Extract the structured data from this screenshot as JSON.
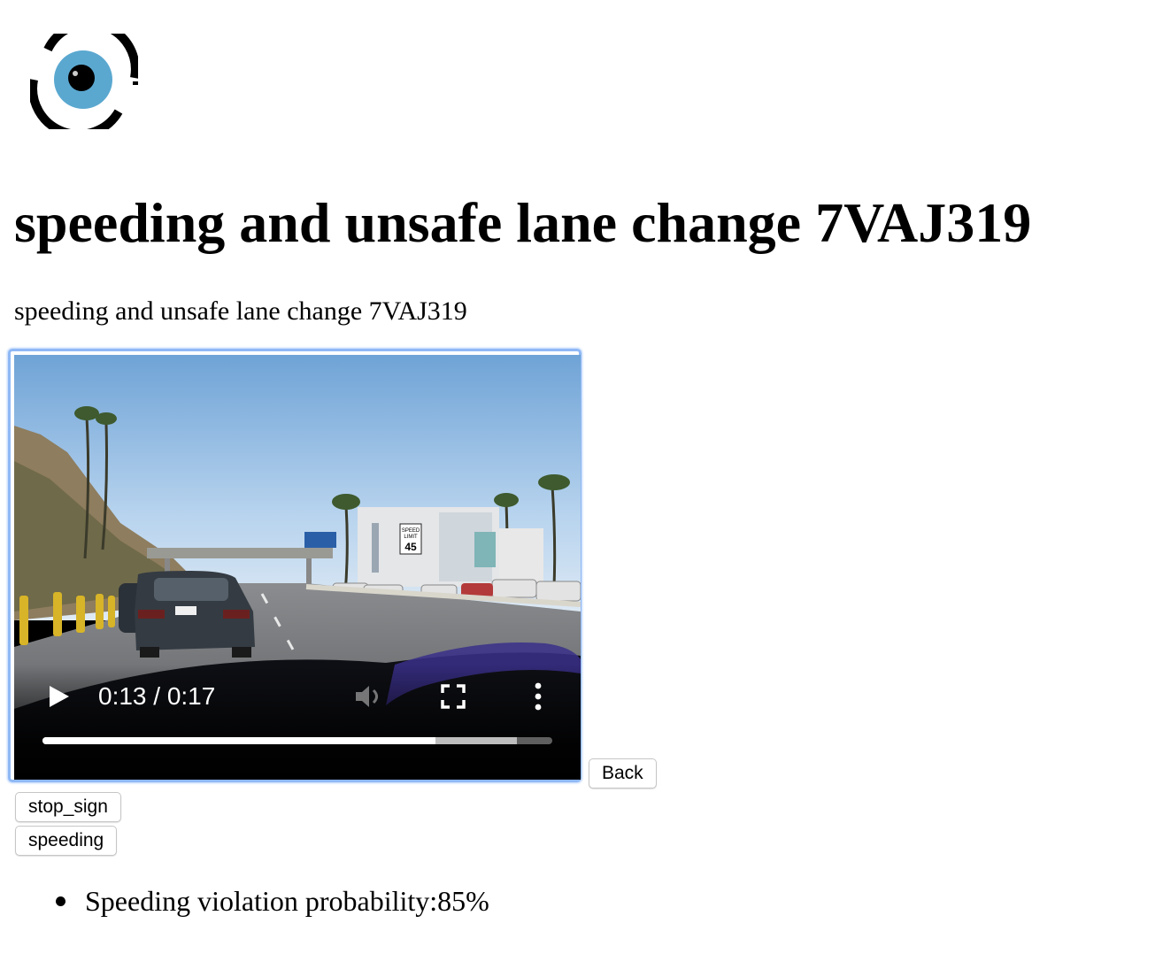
{
  "logo": {
    "icon": "eye-logo",
    "colors": {
      "iris": "#5aa8d0",
      "ring": "#000000"
    }
  },
  "page_title": "speeding and unsafe lane change 7VAJ319",
  "description": "speeding and unsafe lane change 7VAJ319",
  "video": {
    "scene_sign": {
      "line1": "SPEED",
      "line2": "LIMIT",
      "value": "45"
    },
    "time_display": "0:13 / 0:17",
    "progress": {
      "played_fraction": 0.77,
      "buffered_fraction": 0.93
    },
    "controls": [
      "play-icon",
      "volume-muted-icon",
      "fullscreen-icon",
      "more-options-icon"
    ],
    "focus_ring_color": "#8fb8f5"
  },
  "buttons": {
    "back": "Back",
    "stop_sign": "stop_sign",
    "speeding": "speeding"
  },
  "violations": [
    {
      "text": "Speeding violation probability:85%"
    }
  ]
}
